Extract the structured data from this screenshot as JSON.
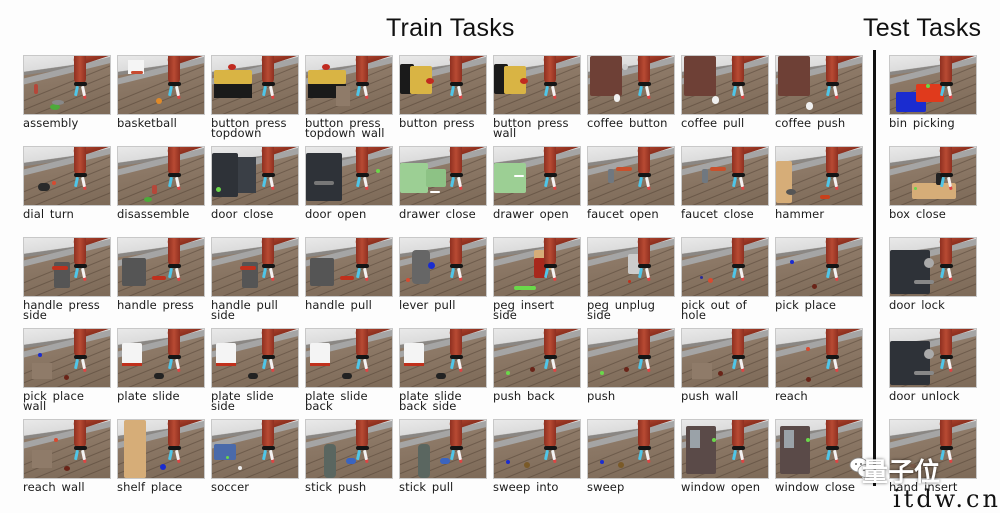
{
  "headings": {
    "train": "Train Tasks",
    "test": "Test Tasks"
  },
  "train_tasks": [
    {
      "label": "assembly",
      "scene": "peg-nut-green"
    },
    {
      "label": "basketball",
      "scene": "hoop-orange-ball"
    },
    {
      "label": "button press\ntopdown",
      "scene": "yellow-button-box-top"
    },
    {
      "label": "button press\ntopdown wall",
      "scene": "yellow-button-box-top-wall"
    },
    {
      "label": "button press",
      "scene": "yellow-button-box-side"
    },
    {
      "label": "button press\nwall",
      "scene": "yellow-button-box-side-wall"
    },
    {
      "label": "coffee button",
      "scene": "coffee-machine"
    },
    {
      "label": "coffee pull",
      "scene": "coffee-machine-mug"
    },
    {
      "label": "coffee push",
      "scene": "coffee-machine-mug-front"
    },
    {
      "label": "dial turn",
      "scene": "dial"
    },
    {
      "label": "disassemble",
      "scene": "peg-nut-red"
    },
    {
      "label": "door close",
      "scene": "safe-door-open"
    },
    {
      "label": "door open",
      "scene": "safe-door-closed"
    },
    {
      "label": "drawer close",
      "scene": "green-drawer-open"
    },
    {
      "label": "drawer open",
      "scene": "green-drawer-closed"
    },
    {
      "label": "faucet open",
      "scene": "faucet"
    },
    {
      "label": "faucet close",
      "scene": "faucet"
    },
    {
      "label": "hammer",
      "scene": "hammer-box"
    },
    {
      "label": "handle press\nside",
      "scene": "handle-box-side"
    },
    {
      "label": "handle press",
      "scene": "handle-box"
    },
    {
      "label": "handle pull\nside",
      "scene": "handle-box-side"
    },
    {
      "label": "handle pull",
      "scene": "handle-box"
    },
    {
      "label": "lever pull",
      "scene": "lever-blue"
    },
    {
      "label": "peg insert\nside",
      "scene": "peg-box-green"
    },
    {
      "label": "peg unplug\nside",
      "scene": "peg-plug"
    },
    {
      "label": "pick out of\nhole",
      "scene": "pick-hole"
    },
    {
      "label": "pick place",
      "scene": "pick-place"
    },
    {
      "label": "pick place\nwall",
      "scene": "pick-place-wall"
    },
    {
      "label": "plate slide",
      "scene": "goal-plate"
    },
    {
      "label": "plate slide\nside",
      "scene": "goal-plate"
    },
    {
      "label": "plate slide\nback",
      "scene": "goal-plate"
    },
    {
      "label": "plate slide\nback side",
      "scene": "goal-plate"
    },
    {
      "label": "push back",
      "scene": "push-puck"
    },
    {
      "label": "push",
      "scene": "push-puck"
    },
    {
      "label": "push wall",
      "scene": "push-wall"
    },
    {
      "label": "reach",
      "scene": "reach"
    },
    {
      "label": "reach wall",
      "scene": "reach-wall"
    },
    {
      "label": "shelf place",
      "scene": "shelf"
    },
    {
      "label": "soccer",
      "scene": "soccer-goal"
    },
    {
      "label": "stick push",
      "scene": "stick-thermos"
    },
    {
      "label": "stick pull",
      "scene": "stick-thermos"
    },
    {
      "label": "sweep into",
      "scene": "sweep"
    },
    {
      "label": "sweep",
      "scene": "sweep"
    },
    {
      "label": "window open",
      "scene": "window"
    },
    {
      "label": "window close",
      "scene": "window"
    }
  ],
  "test_tasks": [
    {
      "label": "bin picking",
      "scene": "bins-red-blue"
    },
    {
      "label": "box close",
      "scene": "box-lid"
    },
    {
      "label": "door lock",
      "scene": "safe-door-lock"
    },
    {
      "label": "door unlock",
      "scene": "safe-door-lock"
    },
    {
      "label": "hand insert",
      "scene": "hand-insert"
    }
  ],
  "watermarks": {
    "brand": "量子位",
    "site": "itdw.cn",
    "icon": "wechat-icon"
  }
}
